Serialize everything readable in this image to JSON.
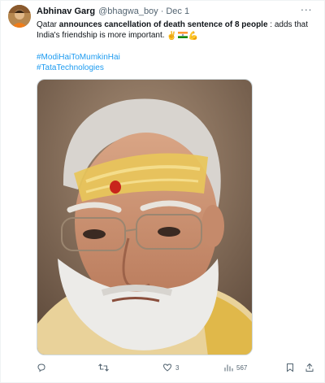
{
  "tweet": {
    "author_name": "Abhinav Garg",
    "author_handle": "@bhagwa_boy",
    "separator": "·",
    "date": "Dec 1",
    "text_prefix": "Qatar ",
    "text_bold": "announces cancellation of death sentence of 8 people",
    "text_suffix": " : adds that India's friendship is more important. ",
    "emoji_hand": "✌",
    "emoji_flex": "💪",
    "hashtags": [
      "#ModiHaiToMumkinHai",
      "#TataTechnologies"
    ],
    "media_alt": "photo",
    "more_glyph": "···"
  },
  "actions": {
    "reply_count": "",
    "retweet_count": "",
    "like_count": "3",
    "views_count": "567"
  },
  "colors": {
    "link": "#1d9bf0",
    "text": "#0f1419",
    "muted": "#536471",
    "border": "#cfd9de"
  },
  "icons": [
    "reply-icon",
    "retweet-icon",
    "like-icon",
    "views-icon",
    "bookmark-icon",
    "share-icon",
    "more-icon",
    "india-flag-icon"
  ]
}
